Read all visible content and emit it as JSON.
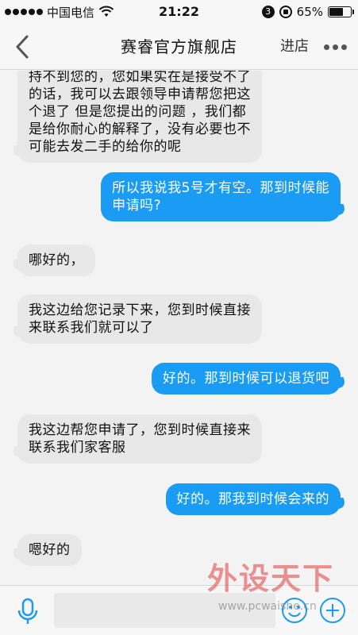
{
  "status_bar": {
    "carrier": "中国电信",
    "time": "21:22",
    "badge": "3",
    "battery": "65%",
    "battery_level": 0.65
  },
  "nav": {
    "title": "赛睿官方旗舰店",
    "enter_label": "进店"
  },
  "messages": [
    {
      "side": "in",
      "lines": [
        "持不到您的，您如果实在是接受不了",
        "的话，我可以去跟领导申请帮您把这",
        "个退了 但是您提出的问题 ，我们都",
        "是给你耐心的解释了，没有必要也不",
        "可能去发二手的给你的呢"
      ]
    },
    {
      "side": "out",
      "lines": [
        "所以我说我5号才有空。那到时候能",
        "申请吗?"
      ]
    },
    {
      "side": "in",
      "lines": [
        "哪好的，"
      ]
    },
    {
      "side": "in",
      "lines": [
        "我这边给您记录下来，您到时候直接",
        "来联系我们就可以了"
      ]
    },
    {
      "side": "out",
      "lines": [
        "好的。那到时候可以退货吧"
      ]
    },
    {
      "side": "in",
      "lines": [
        "我这边帮您申请了，您到时候直接来",
        "联系我们家客服"
      ]
    },
    {
      "side": "out",
      "lines": [
        "好的。那我到时候会来的"
      ]
    },
    {
      "side": "in",
      "lines": [
        "嗯好的"
      ]
    }
  ],
  "input": {
    "value": "",
    "placeholder": ""
  },
  "watermark": {
    "title": "外设天下",
    "url": "www.pcwaishe.cn"
  },
  "colors": {
    "outgoing_bubble": "#1a9bf4",
    "incoming_bubble": "#e8e8e9",
    "icon_blue": "#1a9bf4"
  }
}
